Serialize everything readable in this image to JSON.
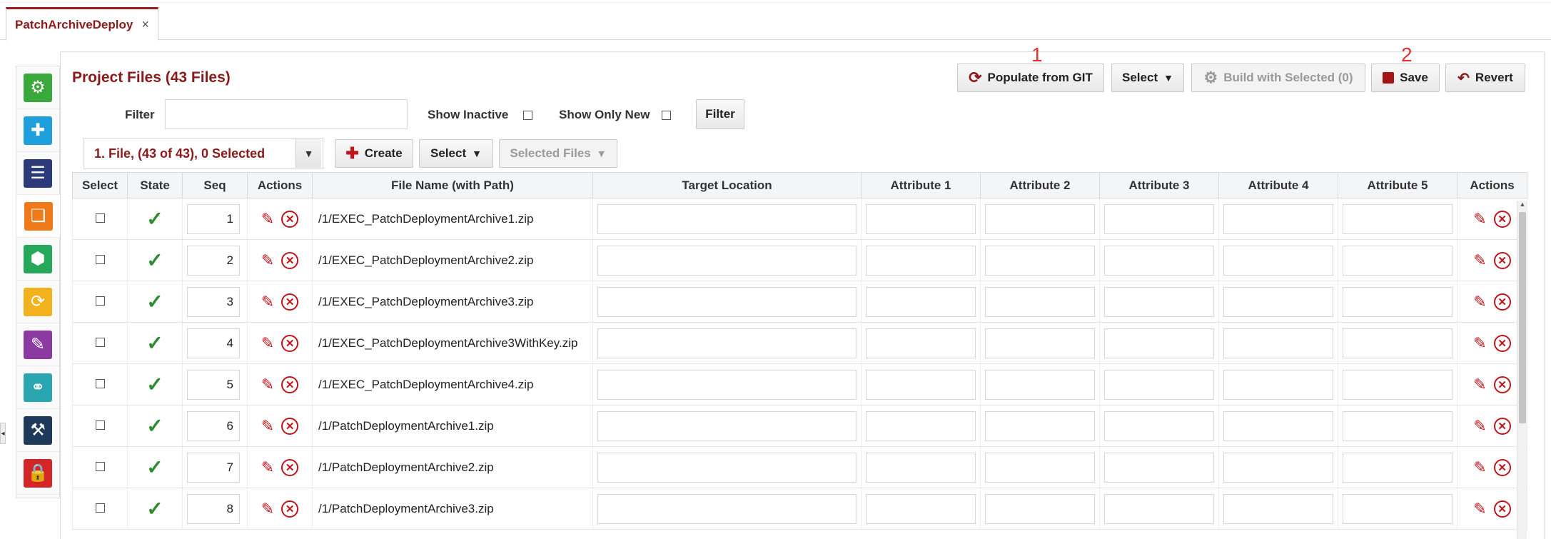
{
  "tab": {
    "label": "PatchArchiveDeploy",
    "close": "×"
  },
  "sidebar": {
    "items": [
      {
        "name": "sidebar-item-build",
        "icon": "gear-puzzle-icon",
        "color": "#3aa83a",
        "glyph": "⚙"
      },
      {
        "name": "sidebar-item-plugins",
        "icon": "plugin-icon",
        "color": "#1fa0dc",
        "glyph": "✚"
      },
      {
        "name": "sidebar-item-list",
        "icon": "list-icon",
        "color": "#2b3b7a",
        "glyph": "☰"
      },
      {
        "name": "sidebar-item-files",
        "icon": "files-icon",
        "color": "#f07a1a",
        "glyph": "❏"
      },
      {
        "name": "sidebar-item-package",
        "icon": "cube-icon",
        "color": "#26a85a",
        "glyph": "⬢"
      },
      {
        "name": "sidebar-item-sync",
        "icon": "sync-icon",
        "color": "#f2b21e",
        "glyph": "⟳"
      },
      {
        "name": "sidebar-item-tests",
        "icon": "clipboard-icon",
        "color": "#8a3aa0",
        "glyph": "✎"
      },
      {
        "name": "sidebar-item-network",
        "icon": "network-icon",
        "color": "#2aa6b0",
        "glyph": "⚭"
      },
      {
        "name": "sidebar-item-robot",
        "icon": "robot-arm-icon",
        "color": "#1e3a5a",
        "glyph": "⚒"
      },
      {
        "name": "sidebar-item-security",
        "icon": "lock-icon",
        "color": "#d42626",
        "glyph": "🔒"
      }
    ]
  },
  "panel": {
    "title": "Project Files (43 Files)",
    "toolbar": {
      "populate": "Populate from GIT",
      "select": "Select",
      "build": "Build with Selected (0)",
      "save": "Save",
      "revert": "Revert"
    },
    "markers": {
      "m1": "1",
      "m2": "2"
    },
    "filter": {
      "label": "Filter",
      "value": "",
      "show_inactive": "Show Inactive",
      "show_only_new": "Show Only New",
      "button": "Filter"
    },
    "subtoolbar": {
      "dropdown": "1. File, (43 of 43), 0 Selected",
      "create": "Create",
      "select": "Select",
      "selected_files": "Selected Files"
    }
  },
  "grid": {
    "headers": [
      "Select",
      "State",
      "Seq",
      "Actions",
      "File Name (with Path)",
      "Target Location",
      "Attribute 1",
      "Attribute 2",
      "Attribute 3",
      "Attribute 4",
      "Attribute 5",
      "Actions"
    ],
    "rows": [
      {
        "seq": "1",
        "file": "/1/EXEC_PatchDeploymentArchive1.zip"
      },
      {
        "seq": "2",
        "file": "/1/EXEC_PatchDeploymentArchive2.zip"
      },
      {
        "seq": "3",
        "file": "/1/EXEC_PatchDeploymentArchive3.zip"
      },
      {
        "seq": "4",
        "file": "/1/EXEC_PatchDeploymentArchive3WithKey.zip"
      },
      {
        "seq": "5",
        "file": "/1/EXEC_PatchDeploymentArchive4.zip"
      },
      {
        "seq": "6",
        "file": "/1/PatchDeploymentArchive1.zip"
      },
      {
        "seq": "7",
        "file": "/1/PatchDeploymentArchive2.zip"
      },
      {
        "seq": "8",
        "file": "/1/PatchDeploymentArchive3.zip"
      }
    ]
  },
  "colors": {
    "accent": "#8b1a1a",
    "edit": "#c0141c",
    "ok": "#2e8b2e"
  }
}
